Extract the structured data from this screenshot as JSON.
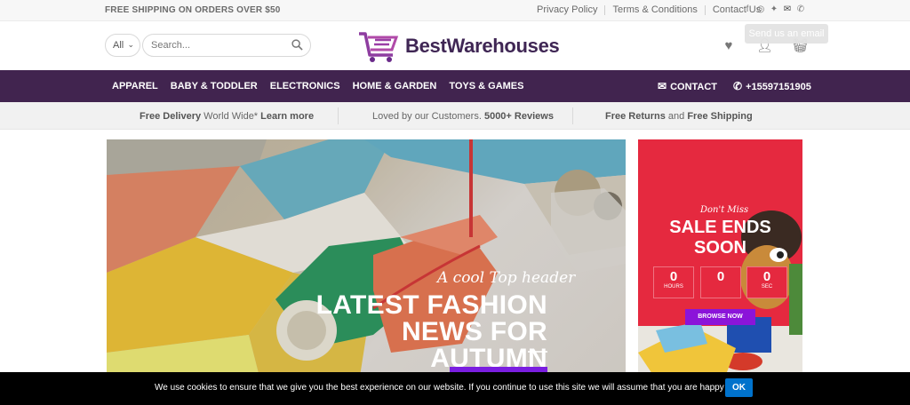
{
  "topbar": {
    "shipping": "FREE SHIPPING ON ORDERS OVER $50",
    "links": [
      "Privacy Policy",
      "Terms & Conditions",
      "Contact Us"
    ],
    "tooltip": "Send us an email"
  },
  "header": {
    "category_select": "All",
    "search_placeholder": "Search...",
    "logo_text": "BestWarehouses"
  },
  "nav": {
    "items": [
      "APPAREL",
      "BABY & TODDLER",
      "ELECTRONICS",
      "HOME & GARDEN",
      "TOYS & GAMES"
    ],
    "contact_label": "CONTACT",
    "phone": "+15597151905"
  },
  "infobar": {
    "delivery_bold": "Free Delivery",
    "delivery_text": " World Wide* ",
    "delivery_link": "Learn more",
    "reviews_text": "Loved by our Customers. ",
    "reviews_bold": "5000+ Reviews",
    "returns_bold": "Free Returns",
    "returns_and": " and ",
    "shipping_bold": "Free Shipping"
  },
  "hero": {
    "cursive": "A cool Top header",
    "title_line1": "LATEST FASHION",
    "title_line2": "NEWS FOR AUTUMN"
  },
  "promo": {
    "dont_miss": "Don't Miss",
    "title_line1": "SALE ENDS",
    "title_line2": "SOON",
    "countdown": [
      {
        "value": "0",
        "label": "HOURS"
      },
      {
        "value": "0",
        "label": ""
      },
      {
        "value": "0",
        "label": "SEC"
      }
    ],
    "button": "BROWSE NOW"
  },
  "cookie": {
    "message": "We use cookies to ensure that we give you the best experience on our website. If you continue to use this site we will assume that you are happy with it.",
    "ok": "OK"
  },
  "colors": {
    "nav_bg": "#41244f",
    "accent_purple": "#7a1ee0",
    "promo_red": "#e5293f",
    "cookie_ok": "#0072cc"
  }
}
